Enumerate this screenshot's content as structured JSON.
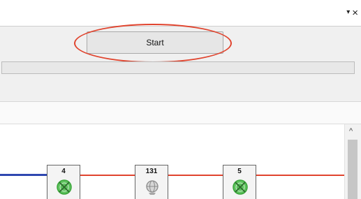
{
  "window": {
    "dropdown_glyph": "▾",
    "close_glyph": "×"
  },
  "toolbar": {
    "start_label": "Start",
    "progress": 0
  },
  "topology": {
    "nodes": [
      {
        "label": "4",
        "status": "ok",
        "icon": "green-crossed-circle"
      },
      {
        "label": "131",
        "status": "inactive",
        "icon": "gray-globe"
      },
      {
        "label": "5",
        "status": "ok",
        "icon": "green-crossed-circle"
      }
    ],
    "colors": {
      "active_link": "#2f47b0",
      "link": "#e0442e",
      "ok": "#3aa63a",
      "inactive": "#9a9a9a"
    }
  },
  "scrollbar": {
    "up_glyph": "^"
  }
}
